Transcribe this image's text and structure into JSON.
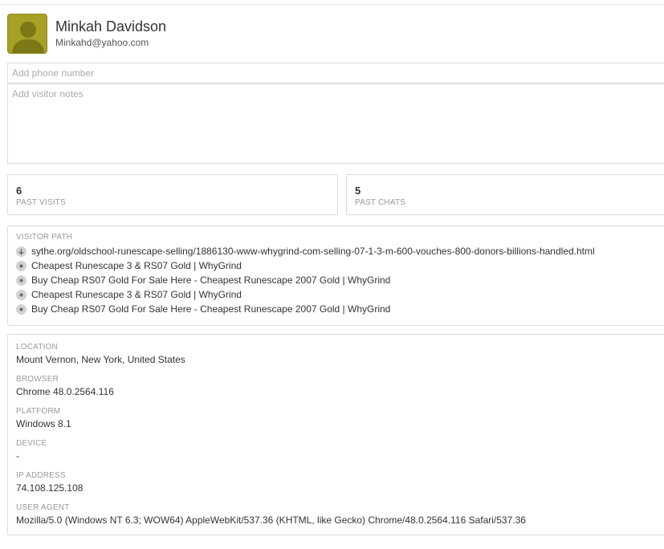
{
  "profile": {
    "name": "Minkah Davidson",
    "email": "Minkahd@yahoo.com",
    "avatar_color": "#a6a126"
  },
  "phone": {
    "placeholder": "Add phone number",
    "value": ""
  },
  "notes": {
    "placeholder": "Add visitor notes",
    "value": ""
  },
  "stats": {
    "visits": {
      "count": "6",
      "label": "PAST VISITS"
    },
    "chats": {
      "count": "5",
      "label": "PAST CHATS"
    }
  },
  "visitor_path": {
    "label": "VISITOR PATH",
    "items": [
      {
        "icon": "arrow-down-icon",
        "text": "sythe.org/oldschool-runescape-selling/1886130-www-whygrind-com-selling-07-1-3-m-600-vouches-800-donors-billions-handled.html"
      },
      {
        "icon": "dot-icon",
        "text": "Cheapest Runescape 3 & RS07 Gold | WhyGrind"
      },
      {
        "icon": "dot-icon",
        "text": "Buy Cheap RS07 Gold For Sale Here - Cheapest Runescape 2007 Gold | WhyGrind"
      },
      {
        "icon": "dot-icon",
        "text": "Cheapest Runescape 3 & RS07 Gold | WhyGrind"
      },
      {
        "icon": "dot-icon",
        "text": "Buy Cheap RS07 Gold For Sale Here - Cheapest Runescape 2007 Gold | WhyGrind"
      }
    ]
  },
  "details": {
    "location": {
      "label": "LOCATION",
      "value": "Mount Vernon, New York, United States"
    },
    "browser": {
      "label": "BROWSER",
      "value": "Chrome 48.0.2564.116"
    },
    "platform": {
      "label": "PLATFORM",
      "value": "Windows 8.1"
    },
    "device": {
      "label": "DEVICE",
      "value": "-"
    },
    "ip_address": {
      "label": "IP ADDRESS",
      "value": "74.108.125.108"
    },
    "user_agent": {
      "label": "USER AGENT",
      "value": "Mozilla/5.0 (Windows NT 6.3; WOW64) AppleWebKit/537.36 (KHTML, like Gecko) Chrome/48.0.2564.116 Safari/537.36"
    }
  }
}
